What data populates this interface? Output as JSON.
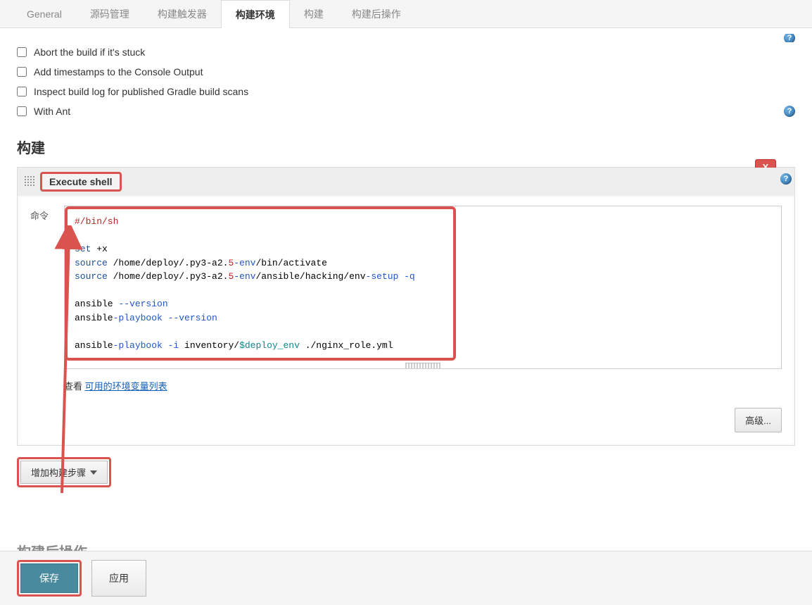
{
  "tabs": {
    "general": "General",
    "scm": "源码管理",
    "triggers": "构建触发器",
    "env": "构建环境",
    "build": "构建",
    "post": "构建后操作"
  },
  "options": {
    "abort": "Abort the build if it's stuck",
    "timestamps": "Add timestamps to the Console Output",
    "gradle": "Inspect build log for published Gradle build scans",
    "ant": "With Ant"
  },
  "section_build": "构建",
  "section_post": "构建后操作",
  "step": {
    "title": "Execute shell",
    "cmd_label": "命令",
    "delete": "X",
    "see_prefix": "查看 ",
    "see_link": "可用的环境变量列表",
    "advanced": "高级..."
  },
  "code": {
    "l1a": "#/bin/sh",
    "l3a": "set",
    "l3b": " +x",
    "l4a": "source",
    "l4b": " /home/deploy/.py3-a2.",
    "l4c": "5",
    "l4d": "-env",
    "l4e": "/bin/activate",
    "l5a": "source",
    "l5b": " /home/deploy/.py3-a2.",
    "l5c": "5",
    "l5d": "-env",
    "l5e": "/ansible/hacking/env",
    "l5f": "-setup -q",
    "l7a": "ansible ",
    "l7b": "--version",
    "l8a": "ansible",
    "l8b": "-playbook ",
    "l8c": "--version",
    "l10a": "ansible",
    "l10b": "-playbook -i",
    "l10c": " inventory/",
    "l10d": "$deploy_env",
    "l10e": " ./nginx_role.yml"
  },
  "add_step": "增加构建步骤",
  "buttons": {
    "save": "保存",
    "apply": "应用"
  }
}
